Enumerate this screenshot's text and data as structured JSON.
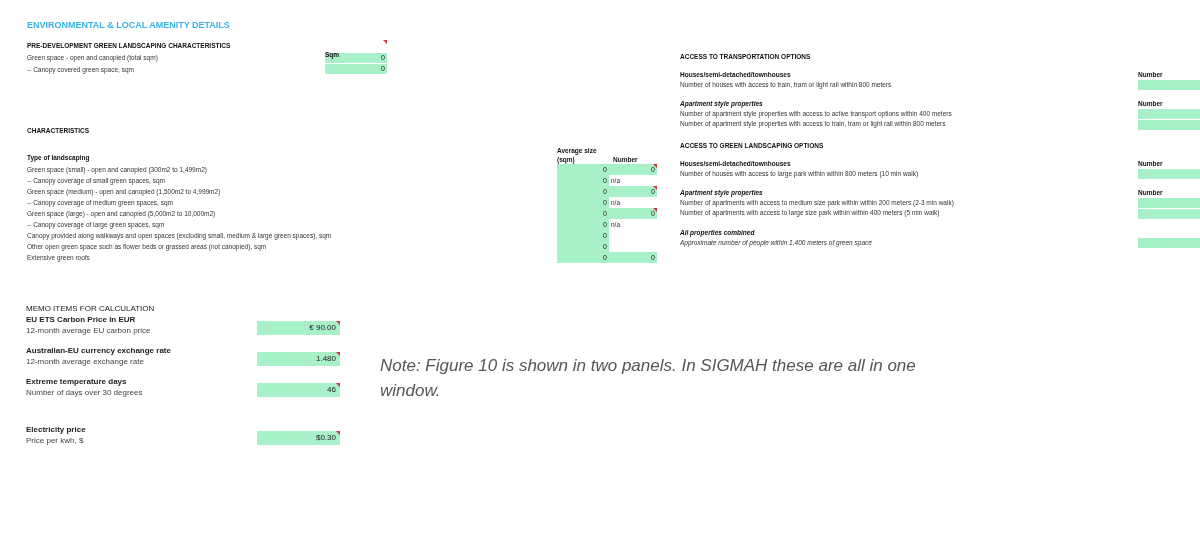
{
  "title": "ENVIRONMENTAL & LOCAL AMENITY DETAILS",
  "pre_development": {
    "heading": "PRE-DEVELOPMENT GREEN LANDSCAPING CHARACTERISTICS",
    "column": "Sqm",
    "comment": true,
    "rows": [
      {
        "label": "Green space - open and canopied (total sqm)",
        "value": "0"
      },
      {
        "label": "-- Canopy covered green space, sqm",
        "value": "0"
      }
    ]
  },
  "characteristics": {
    "heading": "CHARACTERISTICS",
    "subheading": "Type of landscaping",
    "column_1": "Average size (sqm)",
    "column_2": "Number",
    "rows": [
      {
        "label": "Green space (small) - open and canopied (300m2 to 1,499m2)",
        "average_size": "0",
        "kind": "field",
        "number": "0",
        "comment": true
      },
      {
        "label": "-- Canopy coverage of small green spaces, sqm",
        "average_size": "0",
        "kind": "na",
        "number": "n/a",
        "comment": false
      },
      {
        "label": "Green space (medium) - open and canopied (1,500m2 to 4,999m2)",
        "average_size": "0",
        "kind": "field",
        "number": "0",
        "comment": true
      },
      {
        "label": "-- Canopy coverage of medium green spaces, sqm",
        "average_size": "0",
        "kind": "na",
        "number": "n/a",
        "comment": false
      },
      {
        "label": "Green space (large) - open and canopied (5,000m2 to 10,000m2)",
        "average_size": "0",
        "kind": "field",
        "number": "0",
        "comment": true
      },
      {
        "label": "-- Canopy coverage of large green spaces, sqm",
        "average_size": "0",
        "kind": "na",
        "number": "n/a",
        "comment": false
      },
      {
        "label": "Canopy provided along walkways and open spaces (excluding small, medium & large green spaces), sqm",
        "average_size": "0",
        "kind": "none",
        "comment": false
      },
      {
        "label": "Other open green space such as flower beds or grassed areas (not canopied), sqm",
        "average_size": "0",
        "kind": "none",
        "comment": false
      },
      {
        "label": "Extensive green roofs",
        "average_size": "0",
        "kind": "field",
        "number": "0",
        "comment": false
      }
    ]
  },
  "access_sections": [
    {
      "heading": "ACCESS TO TRANSPORTATION OPTIONS",
      "groups": [
        {
          "heading": "Houses/semi-detached/townhouses",
          "italic": false,
          "column": "Number",
          "rows": [
            "Number of houses with access to train, tram or light rail within 800 meters"
          ]
        },
        {
          "heading": "Apartment style properties",
          "italic": true,
          "column": "Number",
          "rows": [
            "Number of apartment style properties with access to active transport options within 400 meters",
            "Number of apartment style properties with access to train, tram or light rail within 800 meters"
          ]
        }
      ]
    },
    {
      "heading": "ACCESS TO GREEN LANDSCAPING OPTIONS",
      "groups": [
        {
          "heading": "Houses/semi-detached/townhouses",
          "italic": false,
          "column": "Number",
          "rows": [
            "Number of houses with access to large park within within 800 meters (10 min walk)"
          ]
        },
        {
          "heading": "Apartment style properties",
          "italic": true,
          "column": "Number",
          "rows": [
            "Number of apartments with access to medium size park within within 200 meters (2-3 min walk)",
            "Number of apartments with access to large size park within within 400 meters (5 min walk)"
          ]
        },
        {
          "heading": "All properties combined",
          "italic": true,
          "rows": [
            "Approximate number of people within 1,400 meters of green space"
          ]
        }
      ]
    }
  ],
  "memo": {
    "heading": "MEMO ITEMS FOR CALCULATION",
    "items": [
      {
        "heading": "EU ETS Carbon Price in EUR",
        "label": "12-month average EU carbon price",
        "value": "€ 90.00",
        "comment": true
      },
      {
        "heading": "Australian-EU currency exchange rate",
        "label": "12-month average exchange rate",
        "value": "1.480",
        "comment": true
      },
      {
        "heading": "Extreme temperature days",
        "label": "Number of days over 30 degrees",
        "value": "46",
        "comment": true
      },
      {
        "heading": "Electricity price",
        "label": "Price per kwh, $",
        "value": "$0.30",
        "comment": true
      }
    ]
  },
  "note": "Note: Figure 10 is shown in two panels. In SIGMAH these are all in one window."
}
